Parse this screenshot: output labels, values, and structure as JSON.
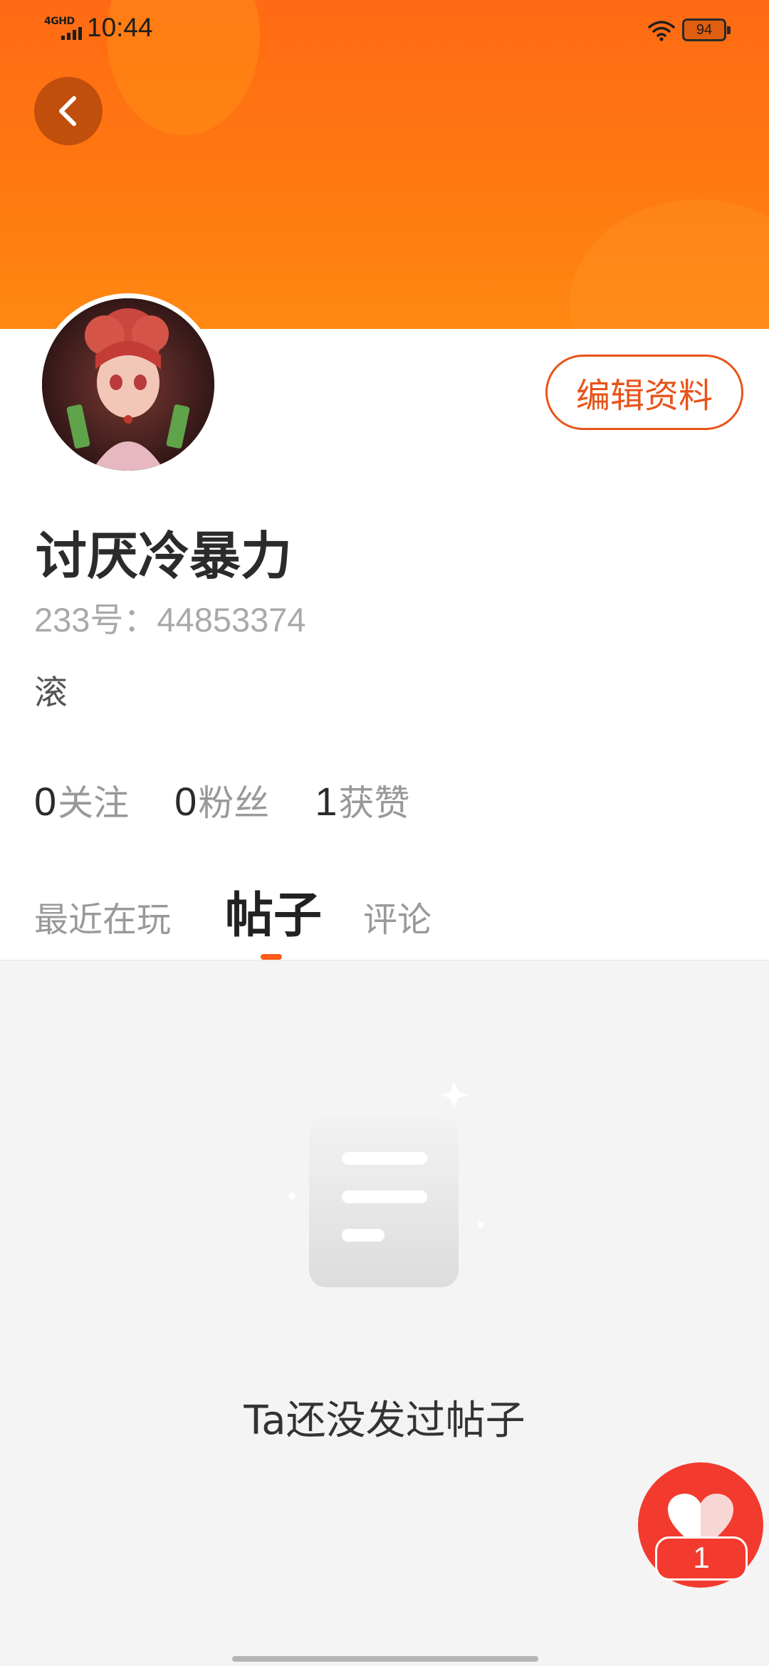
{
  "status_bar": {
    "network": "4GHD",
    "time": "10:44",
    "battery": "94"
  },
  "header": {
    "back_icon": "chevron-left-icon"
  },
  "profile": {
    "edit_label": "编辑资料",
    "nickname": "讨厌冷暴力",
    "uid_label": "233号：",
    "uid_value": "44853374",
    "bio": "滚",
    "stats": [
      {
        "count": "0",
        "label": "关注"
      },
      {
        "count": "0",
        "label": "粉丝"
      },
      {
        "count": "1",
        "label": "获赞"
      }
    ]
  },
  "tabs": [
    {
      "label": "最近在玩",
      "active": false
    },
    {
      "label": "帖子",
      "active": true
    },
    {
      "label": "评论",
      "active": false
    }
  ],
  "empty_state": {
    "icon": "document-icon",
    "text": "Ta还没发过帖子"
  },
  "like_button": {
    "icon": "heart-icon",
    "count": "1"
  },
  "colors": {
    "accent": "#ff6a14",
    "like_red": "#f23a2e",
    "edit_border": "#e8541a",
    "tab_indicator": "#ff5a1a"
  }
}
